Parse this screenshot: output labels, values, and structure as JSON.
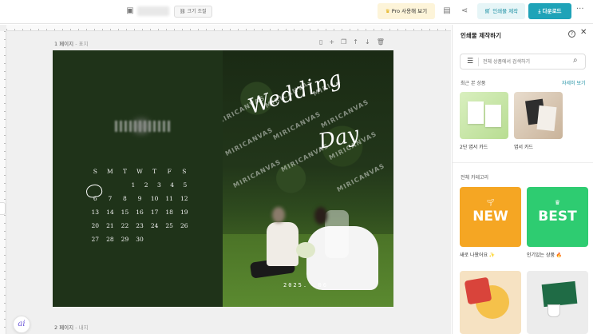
{
  "topbar": {
    "resize_label": "크기 조절",
    "pro_label": "Pro 사용해 보기",
    "print_label": "인쇄물 제작",
    "download_label": "다운로드",
    "more_label": "···"
  },
  "workspace": {
    "page1_label": "1 페이지",
    "page1_sub": "- 표지",
    "page2_label": "2 페이지",
    "page2_sub": "- 내지"
  },
  "calendar": {
    "weekdays": [
      "S",
      "M",
      "T",
      "W",
      "T",
      "F",
      "S"
    ],
    "weeks": [
      [
        "",
        "",
        "",
        "1",
        "2",
        "3",
        "4",
        "5"
      ],
      [
        "6",
        "7",
        "8",
        "9",
        "10",
        "11",
        "12"
      ],
      [
        "13",
        "14",
        "15",
        "16",
        "17",
        "18",
        "19"
      ],
      [
        "20",
        "21",
        "22",
        "23",
        "24",
        "25",
        "26"
      ],
      [
        "27",
        "28",
        "29",
        "30",
        "",
        "",
        ""
      ]
    ]
  },
  "photo": {
    "watermark": "MIRICANVAS",
    "title_line1": "Wedding",
    "title_line2": "Day",
    "date": "2025. .06"
  },
  "ai_fab": "ai",
  "panel": {
    "title": "인쇄물 제작하기",
    "help": "?",
    "close": "✕",
    "search_placeholder": "전체 상품에서 검색하기",
    "recent_label": "최근 본 상품",
    "see_more": "자세히 보기",
    "recent_items": [
      {
        "label": "2단 엽서 카드"
      },
      {
        "label": "엽서 카드"
      }
    ],
    "all_categories_label": "전체 카테고리",
    "categories": [
      {
        "label": "새로 나왔어요 ✨",
        "big": "NEW",
        "color": "#f5a623"
      },
      {
        "label": "인기있는 상품 🔥",
        "big": "BEST",
        "color": "#2ecc71"
      }
    ]
  }
}
